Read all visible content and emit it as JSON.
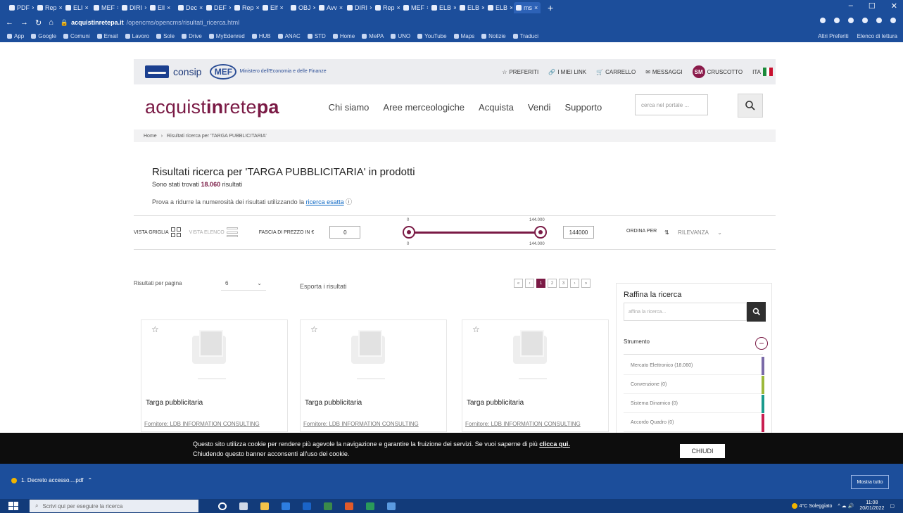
{
  "browser": {
    "tabs": [
      "PDF",
      "Rep",
      "ELI",
      "MEF",
      "DIRI",
      "Ell",
      "Dec",
      "DEF",
      "Rep",
      "Elf",
      "OBJ",
      "Avv",
      "DIRI",
      "Rep",
      "MEF",
      "ELB",
      "ELB",
      "ELB",
      "ms"
    ],
    "url_domain": "acquistinretepa.it",
    "url_path": "/opencms/opencms/risultati_ricerca.html",
    "bookmarks": [
      "App",
      "Google",
      "Comuni",
      "Email",
      "Lavoro",
      "Sole",
      "Drive",
      "MyEdenred",
      "HUB",
      "ANAC",
      "STD",
      "Home",
      "MePA",
      "UNO",
      "YouTube",
      "Maps",
      "Notizie",
      "Traduci"
    ],
    "bookmarks_right": [
      "Altri Preferiti",
      "Elenco di lettura"
    ]
  },
  "topbar": {
    "consip": "consip",
    "mef": "MEF",
    "mef_sub": "Ministero dell'Economia e delle Finanze",
    "links": [
      "PREFERITI",
      "I MIEI LINK",
      "CARRELLO",
      "MESSAGGI"
    ],
    "user_initials": "SM",
    "cruscotto": "CRUSCOTTO",
    "lang": "ITA"
  },
  "header": {
    "logo_a": "acquist",
    "logo_b": "in",
    "logo_c": "rete",
    "logo_d": "pa",
    "nav": [
      "Chi siamo",
      "Aree merceologiche",
      "Acquista",
      "Vendi",
      "Supporto"
    ],
    "search_placeholder": "cerca nel portale ..."
  },
  "breadcrumb": {
    "home": "Home",
    "current": "Risultati ricerca per 'TARGA PUBBLICITARIA'"
  },
  "results": {
    "title": "Risultati ricerca per 'TARGA PUBBLICITARIA' in prodotti",
    "count_prefix": "Sono stati trovati ",
    "count": "18.060",
    "count_suffix": " risultati",
    "hint": "Prova a ridurre la numerosità dei risultati utilizzando la ",
    "hint_link": "ricerca esatta"
  },
  "viewbar": {
    "grid_label": "VISTA GRIGLIA",
    "list_label": "VISTA ELENCO",
    "price_label": "FASCIA DI PREZZO IN €",
    "price_min": "0",
    "price_max": "144000",
    "slider_min_top": "0",
    "slider_max_top": "144.000",
    "slider_min_bottom": "0",
    "slider_max_bottom": "144.000",
    "sort_label": "ORDINA PER",
    "sort_value": "RILEVANZA"
  },
  "listing": {
    "per_page_label": "Risultati per pagina",
    "per_page_value": "6",
    "export": "Esporta i risultati",
    "pages": [
      "«",
      "‹",
      "1",
      "2",
      "3",
      "›",
      "»"
    ]
  },
  "cards": [
    {
      "name": "Targa pubblicitaria",
      "supplier": "Fornitore: LDB INFORMATION CONSULTING"
    },
    {
      "name": "Targa pubblicitaria",
      "supplier": "Fornitore: LDB INFORMATION CONSULTING"
    },
    {
      "name": "Targa pubblicitaria",
      "supplier": "Fornitore: LDB INFORMATION CONSULTING"
    }
  ],
  "refine": {
    "title": "Raffina la ricerca",
    "placeholder": "affina la ricerca...",
    "section": "Strumento",
    "filters": [
      {
        "label": "Mercato Elettronico (18.060)",
        "color": "#7a6aa8"
      },
      {
        "label": "Convenzione (0)",
        "color": "#9cb83a"
      },
      {
        "label": "Sistema Dinamico (0)",
        "color": "#1a9a8c"
      },
      {
        "label": "Accordo Quadro (0)",
        "color": "#c81e50"
      }
    ]
  },
  "cookie": {
    "line1": "Questo sito utilizza cookie per rendere più agevole la navigazione e garantire la fruizione dei servizi. Se vuoi saperne di più ",
    "link": "clicca qui.",
    "line2": "Chiudendo questo banner acconsenti all'uso dei cookie.",
    "close": "CHIUDI"
  },
  "downloads": {
    "file": "1. Decreto accesso....pdf",
    "show_all": "Mostra tutto"
  },
  "taskbar": {
    "search": "Scrivi qui per eseguire la ricerca",
    "weather": "4°C Soleggiato",
    "time": "11:08",
    "date": "20/01/2022"
  }
}
